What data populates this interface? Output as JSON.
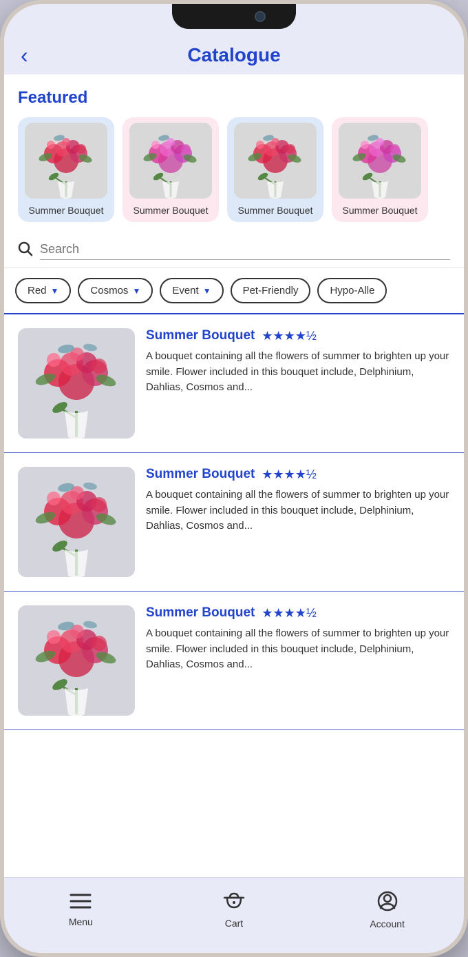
{
  "header": {
    "title": "Catalogue",
    "back_label": "‹"
  },
  "featured": {
    "section_title": "Featured",
    "cards": [
      {
        "label": "Summer\nBouquet",
        "bg": "blue"
      },
      {
        "label": "Summer\nBouquet",
        "bg": "pink"
      },
      {
        "label": "Summer\nBouquet",
        "bg": "blue"
      },
      {
        "label": "Summer\nBouquet",
        "bg": "pink"
      }
    ]
  },
  "search": {
    "placeholder": "Search"
  },
  "filters": [
    {
      "label": "Red",
      "has_chevron": true
    },
    {
      "label": "Cosmos",
      "has_chevron": true
    },
    {
      "label": "Event",
      "has_chevron": true
    },
    {
      "label": "Pet-Friendly",
      "has_chevron": false
    },
    {
      "label": "Hypo-Alle",
      "has_chevron": false
    }
  ],
  "products": [
    {
      "name": "Summer Bouquet",
      "rating": "★★★★½",
      "description": "A bouquet containing all the flowers of summer to brighten up your smile. Flower included in this bouquet include, Delphinium, Dahlias, Cosmos and..."
    },
    {
      "name": "Summer Bouquet",
      "rating": "★★★★½",
      "description": "A bouquet containing all the flowers of summer to brighten up your smile. Flower included in this bouquet include, Delphinium, Dahlias, Cosmos and..."
    },
    {
      "name": "Summer Bouquet",
      "rating": "★★★★½",
      "description": "A bouquet containing all the flowers of summer to brighten up your smile. Flower included in this bouquet include, Delphinium, Dahlias, Cosmos and..."
    }
  ],
  "bottom_nav": [
    {
      "label": "Menu",
      "icon": "menu"
    },
    {
      "label": "Cart",
      "icon": "cart"
    },
    {
      "label": "Account",
      "icon": "account"
    }
  ]
}
